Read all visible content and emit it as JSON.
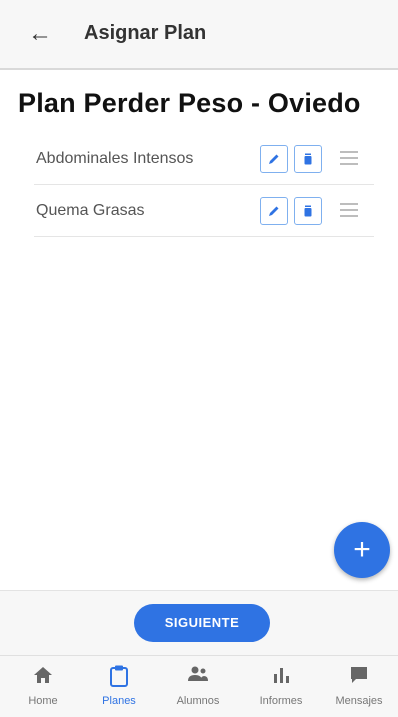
{
  "appbar": {
    "back_icon": "arrow-back-icon",
    "title": "Asignar Plan"
  },
  "plan": {
    "title": "Plan Perder Peso - Oviedo"
  },
  "routines": [
    {
      "name": "Abdominales Intensos",
      "edit_icon": "edit-icon",
      "delete_icon": "delete-icon",
      "drag_icon": "drag-handle-icon"
    },
    {
      "name": "Quema Grasas",
      "edit_icon": "edit-icon",
      "delete_icon": "delete-icon",
      "drag_icon": "drag-handle-icon"
    }
  ],
  "fab": {
    "label": "+",
    "icon": "add-icon"
  },
  "footer": {
    "next_label": "SIGUIENTE"
  },
  "bottom_nav": {
    "active": "Planes",
    "items": [
      {
        "label": "Home",
        "icon": "home-icon"
      },
      {
        "label": "Planes",
        "icon": "clipboard-icon"
      },
      {
        "label": "Alumnos",
        "icon": "students-icon"
      },
      {
        "label": "Informes",
        "icon": "bar-chart-icon"
      },
      {
        "label": "Mensajes",
        "icon": "chat-icon"
      }
    ]
  },
  "colors": {
    "accent": "#2f73e3",
    "icon_border": "#7fb0ef",
    "inactive": "#777777",
    "appbar_bg": "#f7f7f7"
  }
}
